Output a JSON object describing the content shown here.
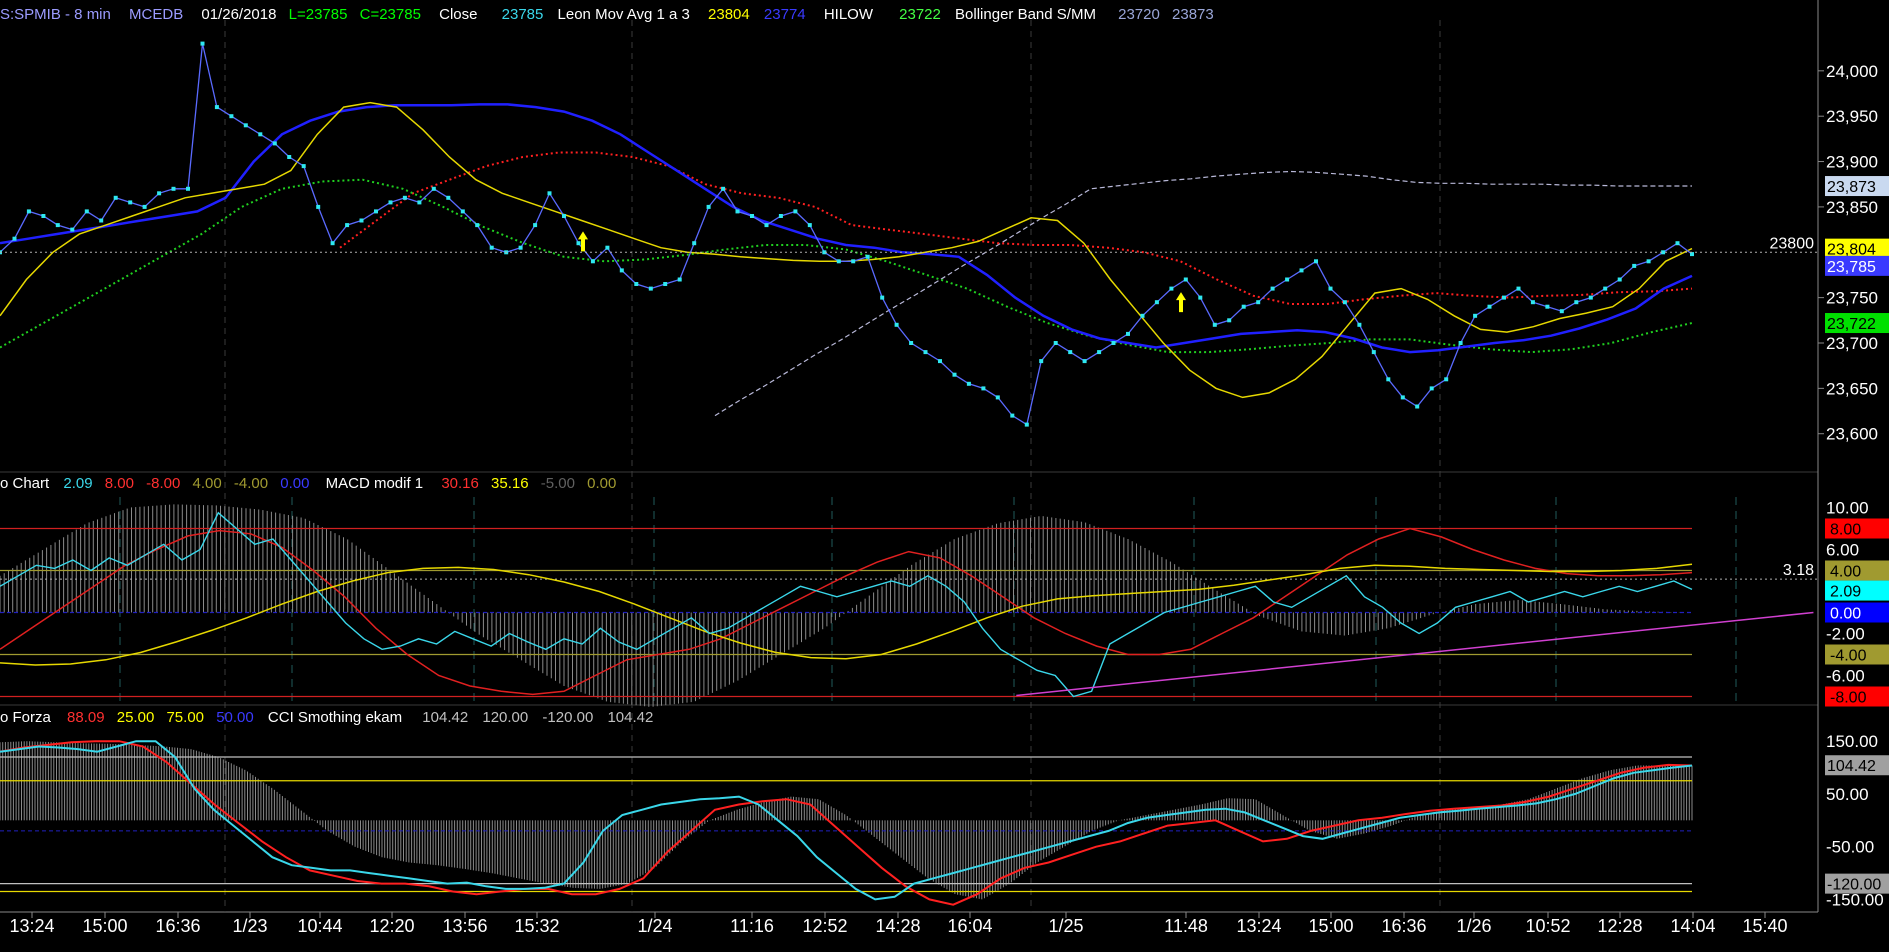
{
  "chart_data": {
    "type": "line",
    "header": {
      "symbol": "S:SPMIB - 8 min",
      "source": "MCEDB",
      "date": "01/26/2018",
      "last": "L=23785",
      "close_label": "C=23785",
      "close_word": "Close",
      "close_value": "23785",
      "mov_avg_name": "Leon Mov Avg 1 a 3",
      "mov_avg_value1": "23804",
      "mov_avg_value2": "23774",
      "hilow_name": "HILOW",
      "hilow_value": "23722",
      "bb_name": "Bollinger Band S/MM",
      "bb_value1": "23720",
      "bb_value2": "23873"
    },
    "price_axis": {
      "ticks": [
        "24,000",
        "23,950",
        "23,900",
        "23,850",
        "23,750",
        "23,700",
        "23,650",
        "23,600"
      ],
      "ylim": [
        23560,
        24045
      ],
      "ref_value": "23800",
      "badges": [
        {
          "value": "23,873",
          "color": "#c9d9f0",
          "text_color": "#000000"
        },
        {
          "value": "23,804",
          "color": "#ffff00",
          "text_color": "#000000"
        },
        {
          "value": "23,785",
          "color": "#3a3aff",
          "text_color": "#ffffff"
        },
        {
          "value": "23,722",
          "color": "#00e000",
          "text_color": "#000000"
        }
      ]
    },
    "indicator1": {
      "label": "o Chart",
      "values": [
        "2.09",
        "8.00",
        "-8.00",
        "4.00",
        "-4.00",
        "0.00"
      ],
      "value_colors": [
        "#3ad7ea",
        "#ff3030",
        "#ff3030",
        "#a09a30",
        "#a09a30",
        "#3a3aff"
      ],
      "macd_name": "MACD modif 1",
      "macd_values": [
        "30.16",
        "35.16",
        "-5.00",
        "0.00"
      ],
      "macd_colors": [
        "#ff3030",
        "#ffff00",
        "#606060",
        "#a09a30"
      ],
      "ticks": [
        "10.00",
        "6.00",
        "-2.00",
        "-6.00"
      ],
      "ylim": [
        -9,
        11
      ],
      "ref_value": "3.18",
      "badges": [
        {
          "value": "8.00",
          "color": "#ff0000",
          "text_color": "#000000"
        },
        {
          "value": "4.00",
          "color": "#a09a30",
          "text_color": "#000000"
        },
        {
          "value": "2.09",
          "color": "#00ffff",
          "text_color": "#000000"
        },
        {
          "value": "0.00",
          "color": "#0000ff",
          "text_color": "#ffffff"
        },
        {
          "value": "-4.00",
          "color": "#a09a30",
          "text_color": "#000000"
        },
        {
          "value": "-8.00",
          "color": "#ff0000",
          "text_color": "#000000"
        }
      ]
    },
    "indicator2": {
      "label": "o Forza",
      "values": [
        "88.09",
        "25.00",
        "75.00",
        "50.00"
      ],
      "value_colors": [
        "#ff3030",
        "#ffff00",
        "#ffff00",
        "#3a3aff"
      ],
      "cci_name": "CCI Smothing ekam",
      "cci_values": [
        "104.42",
        "120.00",
        "-120.00",
        "104.42"
      ],
      "cci_colors": [
        "#c0c0c0",
        "#c0c0c0",
        "#c0c0c0",
        "#c0c0c0"
      ],
      "ticks": [
        "150.00",
        "50.00",
        "-50.00",
        "-150.00"
      ],
      "ylim": [
        -170,
        175
      ],
      "badges": [
        {
          "value": "104.42",
          "color": "#a0a0a0",
          "text_color": "#000000"
        },
        {
          "value": "-120.00",
          "color": "#a0a0a0",
          "text_color": "#000000"
        }
      ]
    },
    "x_axis": {
      "labels": [
        "13:24",
        "15:00",
        "16:36",
        "1/23",
        "10:44",
        "12:20",
        "13:56",
        "15:32",
        "1/24",
        "11:16",
        "12:52",
        "14:28",
        "16:04",
        "1/25",
        "11:48",
        "13:24",
        "15:00",
        "16:36",
        "1/26",
        "10:52",
        "12:28",
        "14:04",
        "15:40"
      ]
    },
    "series": {
      "close": [
        23800,
        23815,
        23845,
        23840,
        23830,
        23825,
        23845,
        23835,
        23860,
        23855,
        23850,
        23865,
        23870,
        23870,
        24030,
        23960,
        23950,
        23940,
        23930,
        23920,
        23905,
        23895,
        23850,
        23810,
        23830,
        23835,
        23845,
        23855,
        23860,
        23855,
        23870,
        23860,
        23845,
        23830,
        23805,
        23800,
        23805,
        23830,
        23865,
        23840,
        23810,
        23790,
        23805,
        23780,
        23765,
        23760,
        23765,
        23770,
        23810,
        23850,
        23870,
        23845,
        23840,
        23830,
        23840,
        23845,
        23830,
        23800,
        23790,
        23790,
        23795,
        23750,
        23720,
        23700,
        23690,
        23680,
        23665,
        23655,
        23650,
        23640,
        23620,
        23610,
        23680,
        23700,
        23690,
        23680,
        23690,
        23700,
        23710,
        23730,
        23745,
        23760,
        23770,
        23750,
        23720,
        23725,
        23740,
        23745,
        23760,
        23770,
        23780,
        23790,
        23760,
        23745,
        23720,
        23690,
        23660,
        23640,
        23630,
        23650,
        23660,
        23700,
        23730,
        23740,
        23750,
        23760,
        23745,
        23740,
        23735,
        23745,
        23750,
        23760,
        23770,
        23785,
        23790,
        23800,
        23810,
        23798
      ],
      "lmavg": [
        23730,
        23770,
        23800,
        23820,
        23830,
        23840,
        23850,
        23860,
        23865,
        23870,
        23875,
        23890,
        23930,
        23960,
        23965,
        23960,
        23935,
        23905,
        23880,
        23865,
        23855,
        23845,
        23835,
        23825,
        23815,
        23805,
        23800,
        23798,
        23795,
        23793,
        23791,
        23790,
        23790,
        23792,
        23795,
        23800,
        23805,
        23812,
        23825,
        23838,
        23835,
        23810,
        23770,
        23735,
        23700,
        23670,
        23650,
        23640,
        23645,
        23660,
        23685,
        23720,
        23755,
        23760,
        23748,
        23730,
        23715,
        23712,
        23718,
        23727,
        23733,
        23740,
        23760,
        23790,
        23804
      ],
      "blue": [
        23810,
        23815,
        23820,
        23825,
        23830,
        23835,
        23840,
        23845,
        23860,
        23900,
        23930,
        23945,
        23955,
        23960,
        23962,
        23962,
        23962,
        23963,
        23963,
        23960,
        23955,
        23945,
        23930,
        23910,
        23890,
        23870,
        23850,
        23835,
        23825,
        23815,
        23808,
        23805,
        23800,
        23798,
        23795,
        23775,
        23750,
        23730,
        23715,
        23705,
        23700,
        23695,
        23700,
        23705,
        23710,
        23712,
        23714,
        23712,
        23705,
        23695,
        23690,
        23692,
        23696,
        23700,
        23703,
        23708,
        23716,
        23726,
        23738,
        23760,
        23774
      ],
      "red": [
        23805,
        23835,
        23865,
        23880,
        23895,
        23905,
        23910,
        23910,
        23905,
        23895,
        23875,
        23865,
        23860,
        23850,
        23830,
        23825,
        23820,
        23815,
        23810,
        23808,
        23808,
        23805,
        23800,
        23790,
        23770,
        23752,
        23743,
        23743,
        23748,
        23752,
        23755,
        23752,
        23750,
        23752,
        23753,
        23756,
        23757,
        23760
      ],
      "green": [
        23695,
        23720,
        23745,
        23770,
        23795,
        23820,
        23850,
        23870,
        23878,
        23880,
        23870,
        23850,
        23828,
        23810,
        23795,
        23790,
        23792,
        23797,
        23803,
        23808,
        23808,
        23803,
        23790,
        23775,
        23760,
        23740,
        23722,
        23708,
        23698,
        23690,
        23690,
        23693,
        23697,
        23700,
        23704,
        23704,
        23698,
        23693,
        23690,
        23693,
        23700,
        23712,
        23722
      ],
      "white": [
        23620,
        23637,
        23653,
        23670,
        23687,
        23703,
        23720,
        23737,
        23753,
        23770,
        23787,
        23803,
        23820,
        23837,
        23853,
        23870,
        23873,
        23876,
        23879,
        23881,
        23884,
        23886,
        23888,
        23889,
        23888,
        23886,
        23884,
        23880,
        23877,
        23876,
        23876,
        23875,
        23875,
        23875,
        23874,
        23874,
        23873,
        23873,
        23873,
        23873
      ],
      "macd_red": [
        -3.5,
        -1.5,
        0.5,
        2.5,
        4.5,
        6.0,
        7.3,
        7.8,
        7.5,
        6.2,
        4.0,
        1.5,
        -1.5,
        -4.0,
        -6.0,
        -7.0,
        -7.5,
        -7.8,
        -7.5,
        -6.0,
        -4.5,
        -4.0,
        -3.5,
        -2.5,
        -1.0,
        0.5,
        2.0,
        3.5,
        4.8,
        5.8,
        5.2,
        3.5,
        1.5,
        -0.5,
        -2.0,
        -3.2,
        -4.0,
        -4.0,
        -3.5,
        -2.0,
        -0.5,
        1.5,
        3.5,
        5.5,
        7.0,
        8.0,
        7.2,
        6.0,
        5.0,
        4.2,
        3.7,
        3.5,
        3.5,
        3.6,
        3.8
      ],
      "macd_yellow": [
        -4.8,
        -5.0,
        -4.9,
        -4.5,
        -3.8,
        -2.8,
        -1.7,
        -0.5,
        0.8,
        2.0,
        3.0,
        3.8,
        4.2,
        4.3,
        4.1,
        3.6,
        2.9,
        2.0,
        0.8,
        -0.5,
        -1.8,
        -2.9,
        -3.8,
        -4.3,
        -4.4,
        -4.0,
        -3.0,
        -1.8,
        -0.5,
        0.6,
        1.3,
        1.6,
        1.8,
        2.0,
        2.2,
        2.6,
        3.1,
        3.6,
        4.2,
        4.5,
        4.4,
        4.2,
        4.1,
        4.0,
        3.9,
        3.9,
        4.0,
        4.2,
        4.6
      ],
      "macd_cyan": [
        2.5,
        3.5,
        4.5,
        4.2,
        5.0,
        4.0,
        5.2,
        4.5,
        5.5,
        6.5,
        5.0,
        6.0,
        9.5,
        8.0,
        6.5,
        7.0,
        5.0,
        3.0,
        1.0,
        -1.0,
        -2.5,
        -3.5,
        -3.2,
        -2.5,
        -3.0,
        -1.8,
        -2.5,
        -3.2,
        -2.0,
        -2.8,
        -3.5,
        -2.5,
        -3.0,
        -1.5,
        -2.8,
        -3.5,
        -2.5,
        -1.5,
        -0.5,
        -2.0,
        -1.5,
        -0.5,
        0.5,
        1.5,
        2.5,
        2.0,
        1.5,
        2.0,
        2.5,
        3.0,
        2.5,
        3.5,
        2.5,
        1.0,
        -1.5,
        -3.5,
        -4.5,
        -5.5,
        -6.0,
        -8.0,
        -7.5,
        -3.0,
        -2.0,
        -1.0,
        0.0,
        0.5,
        1.0,
        1.5,
        2.0,
        2.5,
        1.0,
        0.5,
        1.5,
        2.5,
        3.5,
        1.5,
        0.5,
        -1.0,
        -2.0,
        -1.0,
        0.5,
        1.0,
        1.5,
        2.0,
        1.0,
        1.5,
        2.0,
        1.5,
        2.0,
        2.5,
        2.0,
        2.5,
        3.0,
        2.2
      ],
      "macd_hist": [
        3.5,
        6.0,
        8.5,
        10.0,
        10.3,
        10.2,
        9.8,
        9.0,
        7.0,
        4.0,
        1.0,
        -2.0,
        -4.5,
        -7.0,
        -8.5,
        -9.0,
        -8.5,
        -6.5,
        -4.0,
        -1.5,
        1.5,
        4.5,
        7.0,
        8.5,
        9.2,
        8.6,
        7.0,
        4.8,
        2.2,
        -0.3,
        -1.8,
        -2.2,
        -1.5,
        -0.2,
        0.8,
        1.2,
        0.8,
        0.3,
        0.1,
        0.0
      ],
      "macd_trend": [
        [
          0.538,
          -7.9
        ],
        [
          0.96,
          0.0
        ]
      ],
      "cci_cyan": [
        130,
        135,
        140,
        138,
        135,
        130,
        140,
        150,
        150,
        120,
        60,
        20,
        -10,
        -40,
        -70,
        -85,
        -90,
        -95,
        -95,
        -100,
        -105,
        -110,
        -115,
        -120,
        -118,
        -125,
        -130,
        -130,
        -128,
        -120,
        -80,
        -20,
        10,
        20,
        30,
        35,
        40,
        42,
        45,
        30,
        0,
        -30,
        -70,
        -100,
        -130,
        -150,
        -145,
        -120,
        -110,
        -100,
        -90,
        -80,
        -70,
        -60,
        -50,
        -40,
        -30,
        -20,
        -5,
        5,
        10,
        15,
        20,
        22,
        15,
        0,
        -15,
        -30,
        -35,
        -25,
        -15,
        -5,
        5,
        10,
        15,
        18,
        22,
        25,
        28,
        32,
        40,
        50,
        65,
        80,
        90,
        95,
        100,
        104
      ],
      "cci_red": [
        130,
        138,
        143,
        148,
        150,
        150,
        140,
        110,
        70,
        30,
        -5,
        -40,
        -70,
        -95,
        -105,
        -115,
        -120,
        -120,
        -125,
        -135,
        -140,
        -135,
        -130,
        -130,
        -140,
        -140,
        -130,
        -110,
        -60,
        -20,
        20,
        30,
        36,
        40,
        30,
        -10,
        -50,
        -90,
        -125,
        -150,
        -160,
        -140,
        -110,
        -90,
        -80,
        -65,
        -50,
        -40,
        -25,
        -10,
        -5,
        0,
        -20,
        -40,
        -35,
        -20,
        -10,
        0,
        5,
        12,
        18,
        22,
        25,
        28,
        35,
        45,
        60,
        75,
        90,
        100,
        105,
        104
      ],
      "cci_hist": [
        148,
        150,
        148,
        146,
        145,
        143,
        140,
        135,
        120,
        95,
        60,
        20,
        -20,
        -50,
        -70,
        -80,
        -85,
        -92,
        -100,
        -110,
        -120,
        -128,
        -130,
        -120,
        -90,
        -40,
        0,
        20,
        35,
        45,
        40,
        10,
        -30,
        -70,
        -110,
        -140,
        -150,
        -120,
        -80,
        -50,
        -20,
        0,
        10,
        20,
        30,
        42,
        40,
        10,
        -20,
        -35,
        -25,
        -10,
        10,
        20,
        25,
        30,
        40,
        60,
        80,
        95,
        104,
        104,
        104
      ]
    }
  }
}
